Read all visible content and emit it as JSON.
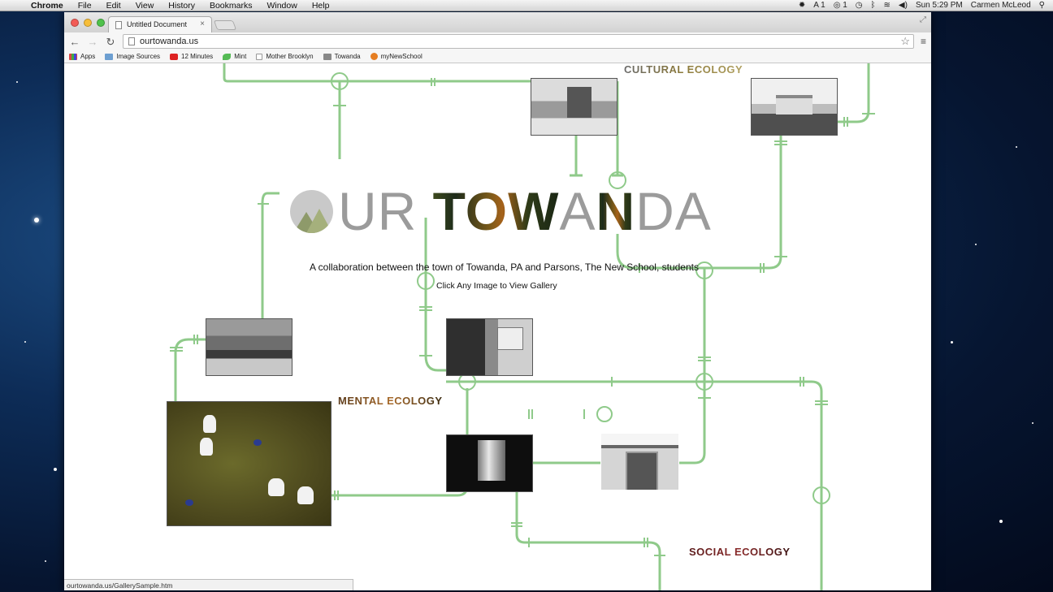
{
  "menubar": {
    "app_name": "Chrome",
    "items": [
      "File",
      "Edit",
      "View",
      "History",
      "Bookmarks",
      "Window",
      "Help"
    ],
    "status": {
      "adobe_count": "1",
      "cc_count": "1",
      "clock": "Sun 5:29 PM",
      "user": "Carmen McLeod"
    }
  },
  "browser": {
    "tab_title": "Untitled Document",
    "url": "ourtowanda.us",
    "bookmarks": [
      {
        "label": "Apps",
        "icon": "apps-grid-icon"
      },
      {
        "label": "Image Sources",
        "icon": "folder-icon"
      },
      {
        "label": "12 Minutes",
        "icon": "youtube-icon"
      },
      {
        "label": "Mint",
        "icon": "mint-leaf-icon"
      },
      {
        "label": "Mother Brooklyn",
        "icon": "page-icon"
      },
      {
        "label": "Towanda",
        "icon": "towanda-icon"
      },
      {
        "label": "myNewSchool",
        "icon": "newschool-icon"
      }
    ],
    "status_url": "ourtowanda.us/GallerySample.htm"
  },
  "page": {
    "logo": {
      "part1": "UR ",
      "part2": "TOW",
      "part3": "A",
      "part4": "N",
      "part5": "DA"
    },
    "tagline": "A collaboration between the town of Towanda, PA and Parsons, The New School, students",
    "cta": "Click Any Image to View Gallery",
    "sections": {
      "cultural": "CULTURAL ECOLOGY",
      "mental": "MENTAL ECOLOGY",
      "social": "SOCIAL ECOLOGY"
    },
    "pipe_color": "#8fca8a"
  }
}
